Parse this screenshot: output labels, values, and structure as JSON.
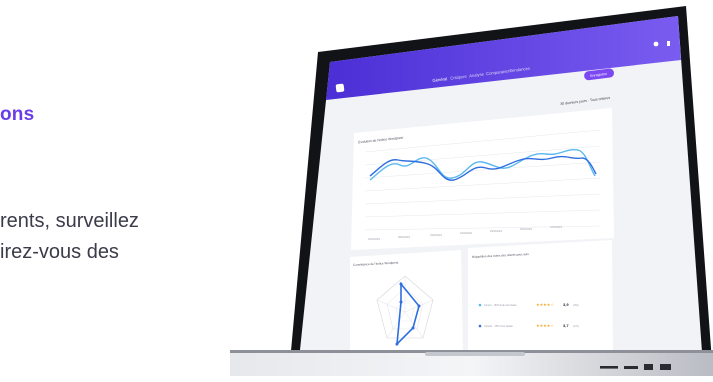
{
  "hero": {
    "headline_fragment": "ons",
    "body_line_1": "rents, surveillez",
    "body_line_2": "irez-vous des"
  },
  "app": {
    "nav_tabs": [
      "Général",
      "Critiques",
      "Analyse",
      "Comparaison",
      "Tendances"
    ],
    "cta_button": "Enregistrer",
    "period_selector": "30 derniers jours · Tous critères",
    "line_chart_title": "Évolution de l'indice Wordprest",
    "radar_title": "Consistance de l'indice Wordprest",
    "distribution_title": "Répartition des notes des clients avec avis",
    "ratings": [
      {
        "label": "Gérard · 1515 Scale Ex Natale",
        "value": "3,9",
        "count": "(184)"
      },
      {
        "label": "Ophélie · 1515 Cleo Natale",
        "value": "3,7",
        "count": "(179)"
      }
    ]
  },
  "colors": {
    "accent": "#6a3de8",
    "brand_gradient_start": "#4b2fd6",
    "brand_gradient_end": "#7a5cf0",
    "line_a": "#2f6ee0",
    "line_b": "#5ab8f0"
  }
}
